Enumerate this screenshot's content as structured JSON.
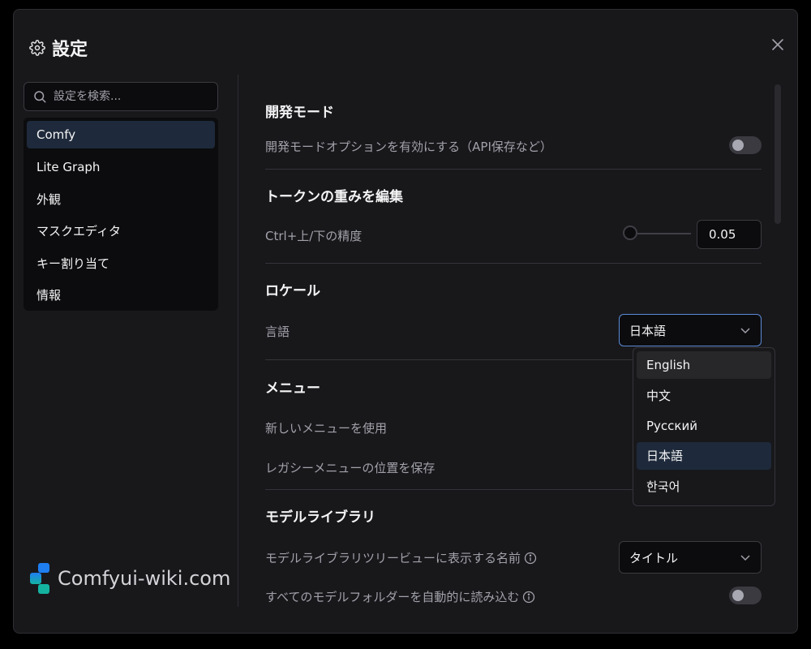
{
  "dialog": {
    "title": "設定",
    "icon": "gear-icon",
    "close_icon": "close-icon"
  },
  "search": {
    "placeholder": "設定を検索...",
    "value": ""
  },
  "sidebar": {
    "items": [
      {
        "label": "Comfy",
        "active": true
      },
      {
        "label": "Lite Graph",
        "active": false
      },
      {
        "label": "外観",
        "active": false
      },
      {
        "label": "マスクエディタ",
        "active": false
      },
      {
        "label": "キー割り当て",
        "active": false
      },
      {
        "label": "情報",
        "active": false
      }
    ]
  },
  "sections": {
    "dev_mode": {
      "title": "開発モード",
      "setting": {
        "label": "開発モードオプションを有効にする（API保存など）",
        "enabled": false
      }
    },
    "token_weight": {
      "title": "トークンの重みを編集",
      "setting": {
        "label": "Ctrl+上/下の精度",
        "value": "0.05",
        "slider_fraction": 0.0
      }
    },
    "locale": {
      "title": "ロケール",
      "setting": {
        "label": "言語",
        "selected": "日本語"
      },
      "options": [
        "English",
        "中文",
        "Русский",
        "日本語",
        "한국어"
      ],
      "hovered_option": "English"
    },
    "menu": {
      "title": "メニュー",
      "settings": [
        {
          "label": "新しいメニューを使用"
        },
        {
          "label": "レガシーメニューの位置を保存"
        }
      ]
    },
    "model_library": {
      "title": "モデルライブラリ",
      "settings": [
        {
          "label": "モデルライブラリツリービューに表示する名前",
          "info_icon": "info-icon",
          "selected": "タイトル"
        },
        {
          "label": "すべてのモデルフォルダーを自動的に読み込む",
          "info_icon": "info-icon",
          "enabled": false
        }
      ]
    }
  },
  "watermark": {
    "text": "Comfyui-wiki.com",
    "colors": {
      "top": "#1e7ef0",
      "bottom": "#14b3a0"
    }
  },
  "colors": {
    "accent_focus": "#5b8bd6",
    "selected_bg": "#1e2a3b",
    "dialog_bg": "#18181b"
  }
}
